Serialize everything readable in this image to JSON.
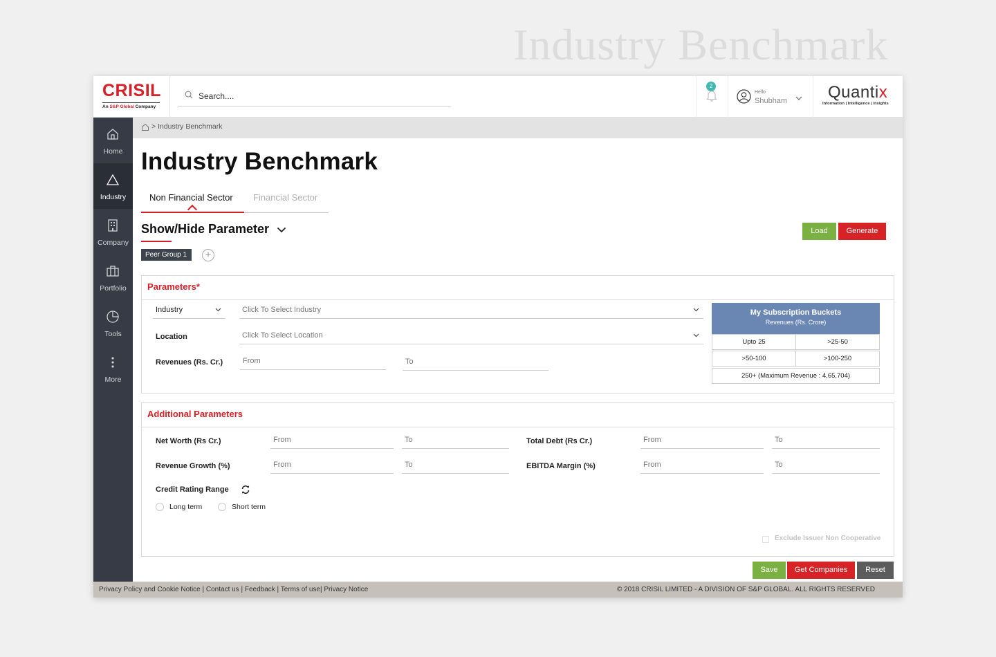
{
  "background_title": "Industry Benchmark",
  "header": {
    "logo_text": "CRISIL",
    "logo_sub_prefix": "An ",
    "logo_sub_brand": "S&P Global",
    "logo_sub_suffix": " Company",
    "search_placeholder": "Search....",
    "notification_count": "2",
    "user_greeting": "Hello",
    "user_name": "Shubham",
    "brand_name_main": "Quanti",
    "brand_name_x": "x",
    "brand_tagline": "Information | Intelligence | Insights"
  },
  "sidebar": {
    "items": [
      {
        "label": "Home",
        "icon": "home-icon"
      },
      {
        "label": "Industry",
        "icon": "triangle-icon",
        "active": true
      },
      {
        "label": "Company",
        "icon": "building-icon"
      },
      {
        "label": "Portfolio",
        "icon": "briefcase-icon"
      },
      {
        "label": "Tools",
        "icon": "pie-chart-icon"
      },
      {
        "label": "More",
        "icon": "more-vertical-icon"
      }
    ]
  },
  "breadcrumb": {
    "separator": ">",
    "current": "Industry Benchmark"
  },
  "page": {
    "title": "Industry Benchmark",
    "tabs": [
      {
        "label": "Non Financial Sector",
        "active": true
      },
      {
        "label": "Financial Sector",
        "active": false
      }
    ],
    "show_hide": "Show/Hide Parameter",
    "load_label": "Load",
    "generate_label": "Generate",
    "peer_group": "Peer Group 1",
    "add_symbol": "+"
  },
  "parameters": {
    "title": "Parameters*",
    "industry_label": "Industry",
    "industry_placeholder": "Click To Select Industry",
    "location_label": "Location",
    "location_placeholder": "Click To Select Location",
    "revenues_label": "Revenues (Rs. Cr.)",
    "from_placeholder": "From",
    "to_placeholder": "To",
    "subscription": {
      "title": "My Subscription Buckets",
      "subtitle": "Revenues (Rs. Crore)",
      "buckets": [
        "Upto 25",
        ">25-50",
        ">50-100",
        ">100-250",
        "250+ (Maximum Revenue : 4,65,704)"
      ]
    }
  },
  "additional": {
    "title": "Additional Parameters",
    "net_worth_label": "Net Worth (Rs Cr.)",
    "total_debt_label": "Total Debt (Rs Cr.)",
    "revenue_growth_label": "Revenue Growth (%)",
    "ebitda_label": "EBITDA Margin (%)",
    "from_placeholder": "From",
    "to_placeholder": "To",
    "credit_label": "Credit Rating Range",
    "long_term": "Long term",
    "short_term": "Short term",
    "exclude_label": "Exclude Issuer Non Cooperative"
  },
  "actions": {
    "save": "Save",
    "get_companies": "Get Companies",
    "reset": "Reset"
  },
  "footer": {
    "links": "Privacy Policy and Cookie Notice | Contact us | Feedback | Terms of use| Privacy Notice",
    "copyright": "© 2018 CRISIL LIMITED - A DIVISION OF S&P GLOBAL. ALL RIGHTS RESERVED"
  },
  "colors": {
    "accent_red": "#d71f27",
    "green": "#7ab142",
    "sidebar": "#363b45",
    "subscription_blue": "#6a86b3"
  }
}
